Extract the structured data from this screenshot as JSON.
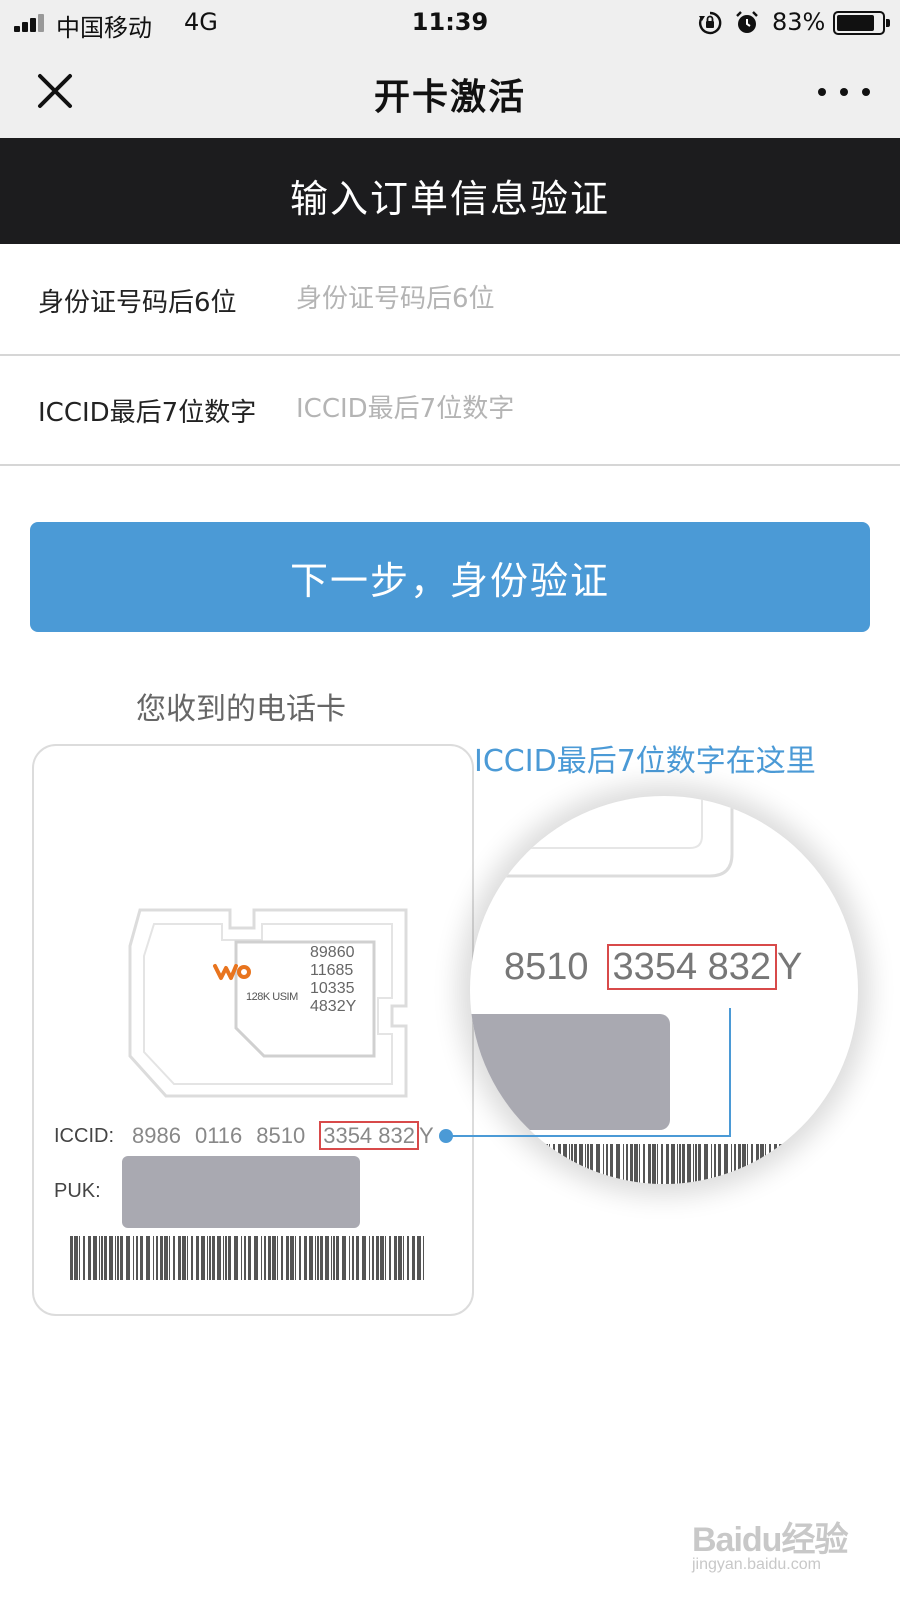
{
  "status_bar": {
    "carrier": "中国移动",
    "network": "4G",
    "time": "11:39",
    "battery_percent": "83%",
    "battery_level": 0.83
  },
  "nav": {
    "title": "开卡激活",
    "close_icon": "close-icon",
    "more_icon": "more-icon"
  },
  "header": {
    "title": "输入订单信息验证"
  },
  "form": {
    "id_last6": {
      "label": "身份证号码后6位",
      "placeholder": "身份证号码后6位",
      "value": ""
    },
    "iccid_last7": {
      "label": "ICCID最后7位数字",
      "placeholder": "ICCID最后7位数字",
      "value": ""
    }
  },
  "next_button": {
    "label": "下一步，身份验证"
  },
  "help": {
    "card_caption": "您收到的电话卡",
    "iccid_hint": "ICCID最后7位数字在这里",
    "sim_brand": "128K USIM",
    "sim_digits": [
      "89860",
      "11685",
      "10335",
      "4832Y"
    ],
    "iccid_label": "ICCID:",
    "iccid_groups": [
      "8986",
      "0116",
      "8510"
    ],
    "iccid_highlight": "3354 832",
    "iccid_suffix": "Y",
    "puk_label": "PUK:",
    "magnified_prefix": "8510",
    "magnified_highlight": "3354  832",
    "magnified_suffix": "Y"
  },
  "colors": {
    "accent_blue": "#4b9ad6",
    "header_dark": "#1c1c1e",
    "highlight_red": "#d84a4a",
    "logo_orange": "#e8741e"
  },
  "watermark": {
    "brand": "Baidu经验",
    "url": "jingyan.baidu.com"
  }
}
